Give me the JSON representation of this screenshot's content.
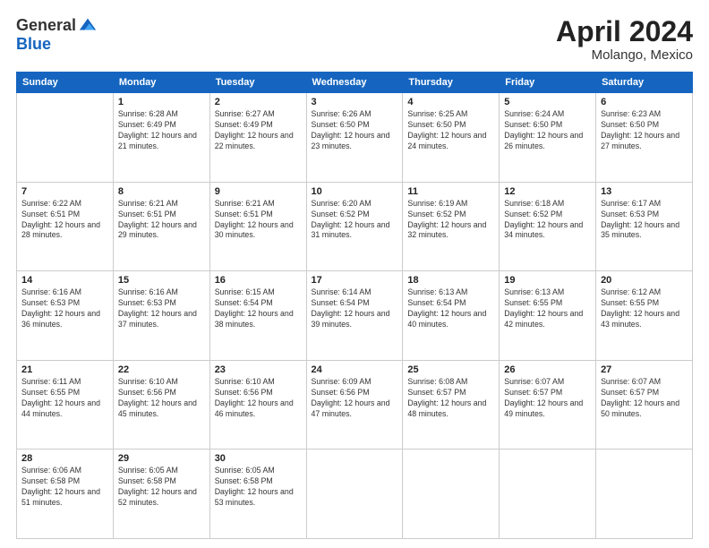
{
  "header": {
    "logo_general": "General",
    "logo_blue": "Blue",
    "month": "April 2024",
    "location": "Molango, Mexico"
  },
  "weekdays": [
    "Sunday",
    "Monday",
    "Tuesday",
    "Wednesday",
    "Thursday",
    "Friday",
    "Saturday"
  ],
  "weeks": [
    [
      {
        "day": "",
        "sunrise": "",
        "sunset": "",
        "daylight": ""
      },
      {
        "day": "1",
        "sunrise": "Sunrise: 6:28 AM",
        "sunset": "Sunset: 6:49 PM",
        "daylight": "Daylight: 12 hours and 21 minutes."
      },
      {
        "day": "2",
        "sunrise": "Sunrise: 6:27 AM",
        "sunset": "Sunset: 6:49 PM",
        "daylight": "Daylight: 12 hours and 22 minutes."
      },
      {
        "day": "3",
        "sunrise": "Sunrise: 6:26 AM",
        "sunset": "Sunset: 6:50 PM",
        "daylight": "Daylight: 12 hours and 23 minutes."
      },
      {
        "day": "4",
        "sunrise": "Sunrise: 6:25 AM",
        "sunset": "Sunset: 6:50 PM",
        "daylight": "Daylight: 12 hours and 24 minutes."
      },
      {
        "day": "5",
        "sunrise": "Sunrise: 6:24 AM",
        "sunset": "Sunset: 6:50 PM",
        "daylight": "Daylight: 12 hours and 26 minutes."
      },
      {
        "day": "6",
        "sunrise": "Sunrise: 6:23 AM",
        "sunset": "Sunset: 6:50 PM",
        "daylight": "Daylight: 12 hours and 27 minutes."
      }
    ],
    [
      {
        "day": "7",
        "sunrise": "Sunrise: 6:22 AM",
        "sunset": "Sunset: 6:51 PM",
        "daylight": "Daylight: 12 hours and 28 minutes."
      },
      {
        "day": "8",
        "sunrise": "Sunrise: 6:21 AM",
        "sunset": "Sunset: 6:51 PM",
        "daylight": "Daylight: 12 hours and 29 minutes."
      },
      {
        "day": "9",
        "sunrise": "Sunrise: 6:21 AM",
        "sunset": "Sunset: 6:51 PM",
        "daylight": "Daylight: 12 hours and 30 minutes."
      },
      {
        "day": "10",
        "sunrise": "Sunrise: 6:20 AM",
        "sunset": "Sunset: 6:52 PM",
        "daylight": "Daylight: 12 hours and 31 minutes."
      },
      {
        "day": "11",
        "sunrise": "Sunrise: 6:19 AM",
        "sunset": "Sunset: 6:52 PM",
        "daylight": "Daylight: 12 hours and 32 minutes."
      },
      {
        "day": "12",
        "sunrise": "Sunrise: 6:18 AM",
        "sunset": "Sunset: 6:52 PM",
        "daylight": "Daylight: 12 hours and 34 minutes."
      },
      {
        "day": "13",
        "sunrise": "Sunrise: 6:17 AM",
        "sunset": "Sunset: 6:53 PM",
        "daylight": "Daylight: 12 hours and 35 minutes."
      }
    ],
    [
      {
        "day": "14",
        "sunrise": "Sunrise: 6:16 AM",
        "sunset": "Sunset: 6:53 PM",
        "daylight": "Daylight: 12 hours and 36 minutes."
      },
      {
        "day": "15",
        "sunrise": "Sunrise: 6:16 AM",
        "sunset": "Sunset: 6:53 PM",
        "daylight": "Daylight: 12 hours and 37 minutes."
      },
      {
        "day": "16",
        "sunrise": "Sunrise: 6:15 AM",
        "sunset": "Sunset: 6:54 PM",
        "daylight": "Daylight: 12 hours and 38 minutes."
      },
      {
        "day": "17",
        "sunrise": "Sunrise: 6:14 AM",
        "sunset": "Sunset: 6:54 PM",
        "daylight": "Daylight: 12 hours and 39 minutes."
      },
      {
        "day": "18",
        "sunrise": "Sunrise: 6:13 AM",
        "sunset": "Sunset: 6:54 PM",
        "daylight": "Daylight: 12 hours and 40 minutes."
      },
      {
        "day": "19",
        "sunrise": "Sunrise: 6:13 AM",
        "sunset": "Sunset: 6:55 PM",
        "daylight": "Daylight: 12 hours and 42 minutes."
      },
      {
        "day": "20",
        "sunrise": "Sunrise: 6:12 AM",
        "sunset": "Sunset: 6:55 PM",
        "daylight": "Daylight: 12 hours and 43 minutes."
      }
    ],
    [
      {
        "day": "21",
        "sunrise": "Sunrise: 6:11 AM",
        "sunset": "Sunset: 6:55 PM",
        "daylight": "Daylight: 12 hours and 44 minutes."
      },
      {
        "day": "22",
        "sunrise": "Sunrise: 6:10 AM",
        "sunset": "Sunset: 6:56 PM",
        "daylight": "Daylight: 12 hours and 45 minutes."
      },
      {
        "day": "23",
        "sunrise": "Sunrise: 6:10 AM",
        "sunset": "Sunset: 6:56 PM",
        "daylight": "Daylight: 12 hours and 46 minutes."
      },
      {
        "day": "24",
        "sunrise": "Sunrise: 6:09 AM",
        "sunset": "Sunset: 6:56 PM",
        "daylight": "Daylight: 12 hours and 47 minutes."
      },
      {
        "day": "25",
        "sunrise": "Sunrise: 6:08 AM",
        "sunset": "Sunset: 6:57 PM",
        "daylight": "Daylight: 12 hours and 48 minutes."
      },
      {
        "day": "26",
        "sunrise": "Sunrise: 6:07 AM",
        "sunset": "Sunset: 6:57 PM",
        "daylight": "Daylight: 12 hours and 49 minutes."
      },
      {
        "day": "27",
        "sunrise": "Sunrise: 6:07 AM",
        "sunset": "Sunset: 6:57 PM",
        "daylight": "Daylight: 12 hours and 50 minutes."
      }
    ],
    [
      {
        "day": "28",
        "sunrise": "Sunrise: 6:06 AM",
        "sunset": "Sunset: 6:58 PM",
        "daylight": "Daylight: 12 hours and 51 minutes."
      },
      {
        "day": "29",
        "sunrise": "Sunrise: 6:05 AM",
        "sunset": "Sunset: 6:58 PM",
        "daylight": "Daylight: 12 hours and 52 minutes."
      },
      {
        "day": "30",
        "sunrise": "Sunrise: 6:05 AM",
        "sunset": "Sunset: 6:58 PM",
        "daylight": "Daylight: 12 hours and 53 minutes."
      },
      {
        "day": "",
        "sunrise": "",
        "sunset": "",
        "daylight": ""
      },
      {
        "day": "",
        "sunrise": "",
        "sunset": "",
        "daylight": ""
      },
      {
        "day": "",
        "sunrise": "",
        "sunset": "",
        "daylight": ""
      },
      {
        "day": "",
        "sunrise": "",
        "sunset": "",
        "daylight": ""
      }
    ]
  ]
}
